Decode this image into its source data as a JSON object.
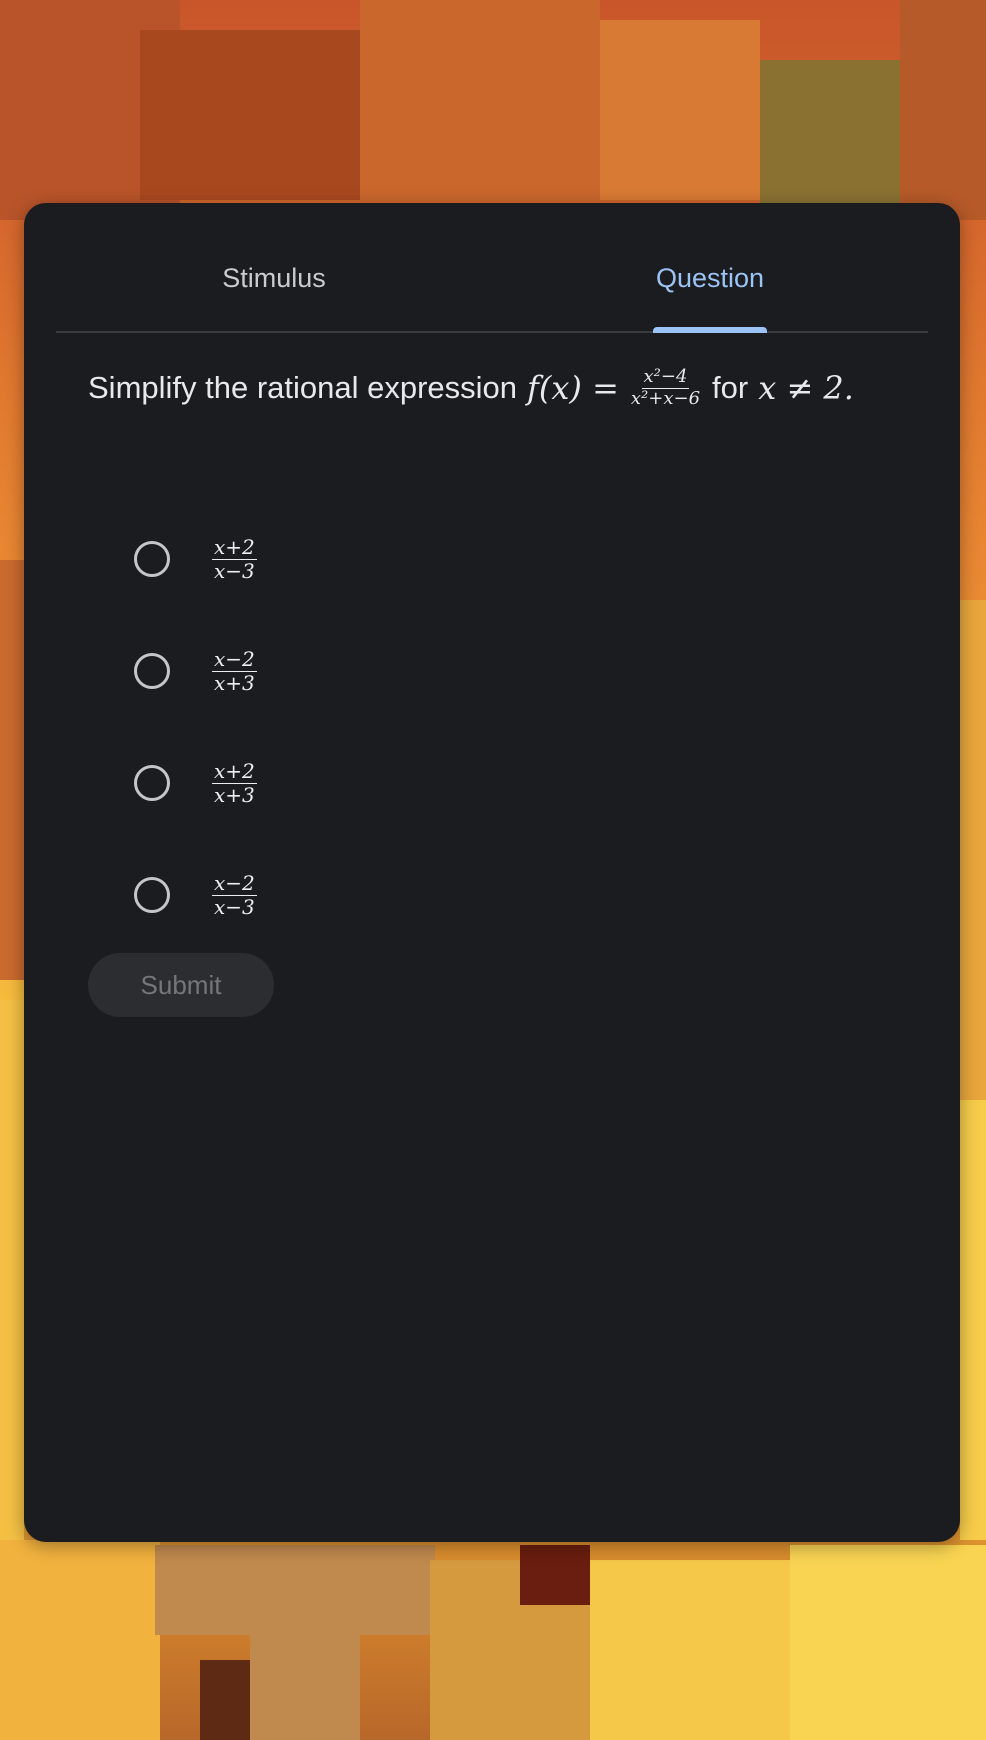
{
  "tabs": [
    {
      "label": "Stimulus",
      "active": false
    },
    {
      "label": "Question",
      "active": true
    }
  ],
  "question": {
    "prefix": "Simplify the rational expression",
    "function_lhs": "f(x) =",
    "fraction": {
      "numerator": "x²−4",
      "denominator": "x²+x−6"
    },
    "suffix_word": "for",
    "condition": "x ≠ 2."
  },
  "options": [
    {
      "numerator": "x+2",
      "denominator": "x−3",
      "selected": false
    },
    {
      "numerator": "x−2",
      "denominator": "x+3",
      "selected": false
    },
    {
      "numerator": "x+2",
      "denominator": "x+3",
      "selected": false
    },
    {
      "numerator": "x−2",
      "denominator": "x−3",
      "selected": false
    }
  ],
  "submit_label": "Submit",
  "colors": {
    "card_bg": "#1b1c20",
    "accent": "#9cc3f5",
    "text": "#e8e9eb",
    "submit_bg": "#2c2d31",
    "submit_text": "#74767b"
  }
}
